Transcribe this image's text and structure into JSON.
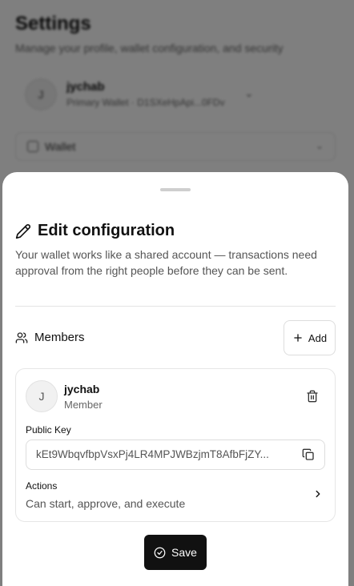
{
  "background": {
    "title": "Settings",
    "subtitle": "Manage your profile, wallet configuration, and security",
    "profile": {
      "avatar_initial": "J",
      "name": "jychab",
      "wallet_text": "Primary Wallet · D1SXeHpApi...0FDv"
    },
    "select": {
      "label": "Wallet"
    }
  },
  "sheet": {
    "title": "Edit configuration",
    "description": "Your wallet works like a shared account — transactions need approval from the right people before they can be sent.",
    "members_label": "Members",
    "add_label": "Add",
    "member": {
      "avatar_initial": "J",
      "name": "jychab",
      "role": "Member",
      "public_key_label": "Public Key",
      "public_key": "kEt9WbqvfbpVsxPj4LR4MPJWBzjmT8AfbFjZY...",
      "actions_label": "Actions",
      "actions_value": "Can start, approve, and execute"
    },
    "save_label": "Save"
  },
  "icons": {
    "title": "pencil-icon",
    "members": "users-icon",
    "add": "plus-icon",
    "delete": "trash-icon",
    "copy": "copy-icon",
    "actions": "chevron-right-icon",
    "save": "check-circle-icon"
  },
  "colors": {
    "overlay": "#000000",
    "primary_button": "#111111",
    "border": "#dddddd"
  }
}
